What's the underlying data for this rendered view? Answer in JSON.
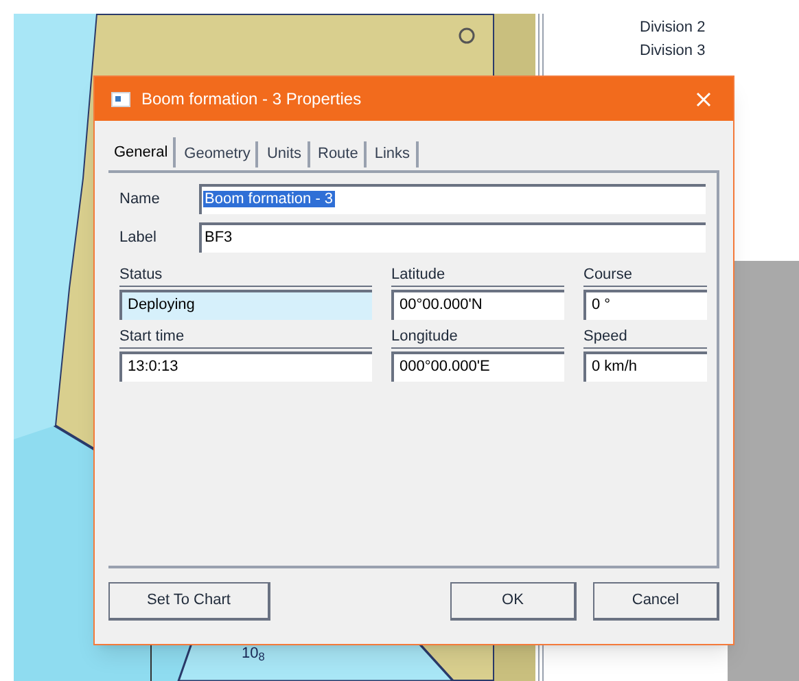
{
  "window": {
    "title": "Boom formation - 3 Properties"
  },
  "background": {
    "tree_items": [
      "Division 2",
      "Division 3"
    ],
    "chart_label": "10$_{8}$"
  },
  "tabs": [
    {
      "label": "General",
      "selected": true
    },
    {
      "label": "Geometry",
      "selected": false
    },
    {
      "label": "Units",
      "selected": false
    },
    {
      "label": "Route",
      "selected": false
    },
    {
      "label": "Links",
      "selected": false
    }
  ],
  "fields": [
    {
      "label": "Name",
      "value": "Boom formation - 3",
      "selected": true
    },
    {
      "label": "Label",
      "value": "BF3",
      "selected": false
    }
  ],
  "grid_fields": [
    {
      "label": "Status",
      "value": "Deploying",
      "highlighted": true
    },
    {
      "label": "Latitude",
      "value": "00°00.000'N",
      "highlighted": false
    },
    {
      "label": "Course",
      "value": "0 °",
      "highlighted": false
    },
    {
      "label": "Start time",
      "value": "13:0:13",
      "highlighted": false
    },
    {
      "label": "Longitude",
      "value": "000°00.000'E",
      "highlighted": false
    },
    {
      "label": "Speed",
      "value": "0 km/h",
      "highlighted": false
    }
  ],
  "buttons": [
    "Set To Chart",
    "OK",
    "Cancel"
  ]
}
